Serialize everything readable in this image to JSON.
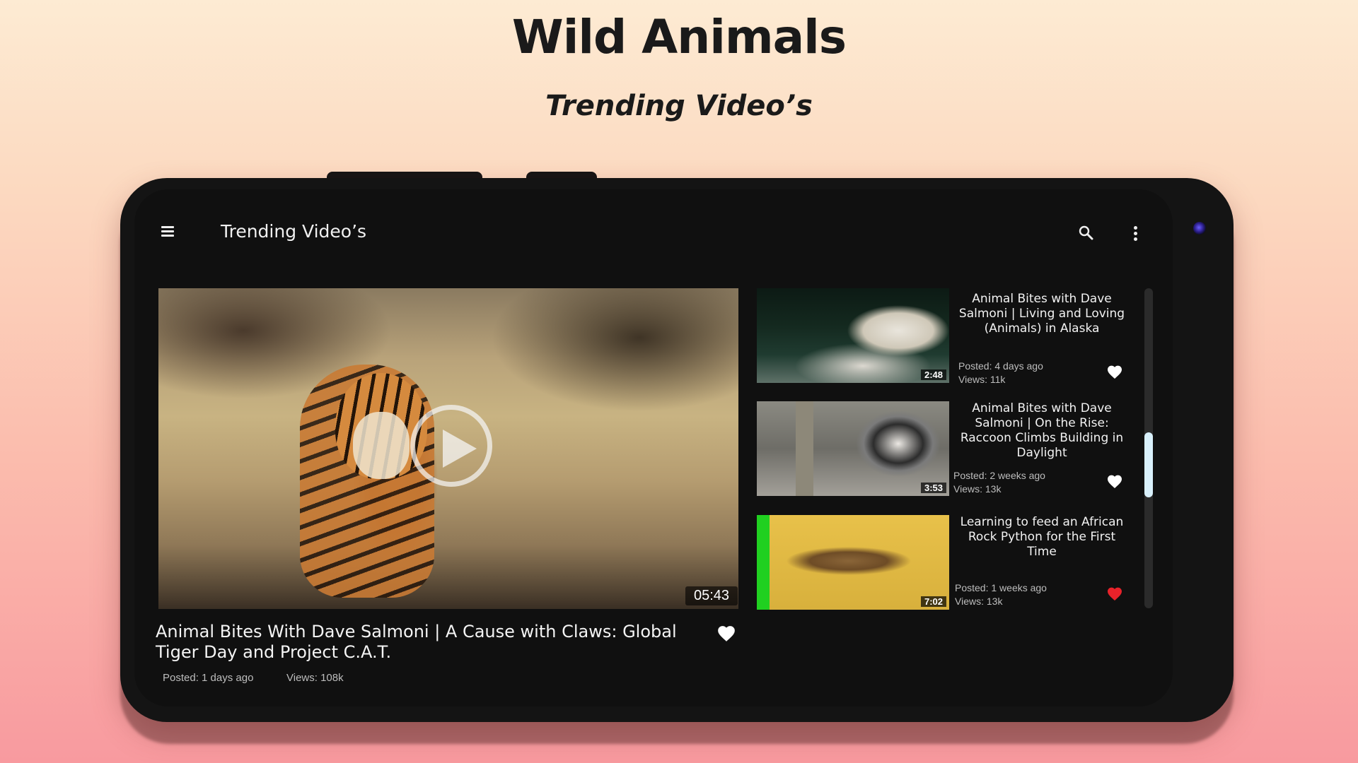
{
  "promo": {
    "title": "Wild Animals",
    "subtitle": "Trending Video’s"
  },
  "appbar": {
    "title": "Trending Video’s",
    "menu_icon": "menu-icon",
    "search_icon": "search-icon",
    "more_icon": "more-vert-icon"
  },
  "main_video": {
    "title": "Animal Bites With Dave Salmoni | A Cause with Claws: Global Tiger Day and Project C.A.T.",
    "duration": "05:43",
    "posted": "Posted: 1 days ago",
    "views": "Views: 108k",
    "favorited": false
  },
  "video_list": [
    {
      "title": "Animal Bites with Dave Salmoni | Living and Loving (Animals) in Alaska",
      "duration": "2:48",
      "posted": "Posted: 4 days ago",
      "views": "Views: 11k",
      "favorited": false
    },
    {
      "title": "Animal Bites with Dave Salmoni | On the Rise: Raccoon Climbs Building in Daylight",
      "duration": "3:53",
      "posted": "Posted: 2 weeks ago",
      "views": "Views: 13k",
      "favorited": false
    },
    {
      "title": "Learning to feed an African Rock Python for the First Time",
      "duration": "7:02",
      "posted": "Posted: 1 weeks ago",
      "views": "Views: 13k",
      "favorited": true
    }
  ],
  "colors": {
    "heart_default": "#ffffff",
    "heart_favorited": "#e8222a",
    "scroll_thumb": "#d8f0fb",
    "screen_bg": "#101010"
  }
}
